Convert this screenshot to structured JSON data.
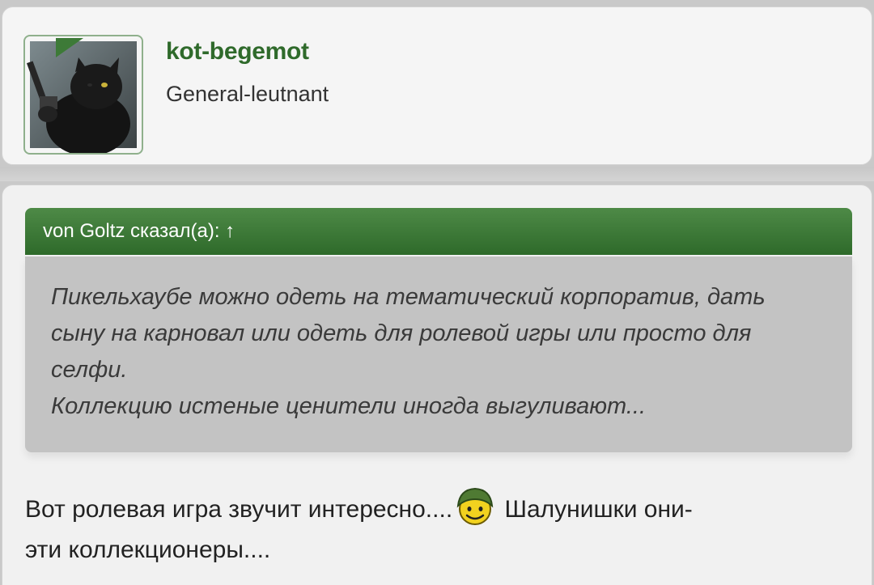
{
  "user": {
    "name": "kot-begemot",
    "rank": "General-leutnant"
  },
  "quote": {
    "header": "von Goltz сказал(а): ↑",
    "lines": [
      "Пикельхаубе можно одеть на тематический корпоратив, дать",
      "сыну на карновал или одеть для ролевой игры или просто для",
      "селфи.",
      "Коллекцию истеные ценители иногда выгуливают..."
    ]
  },
  "reply": {
    "part1": "Вот ролевая игра звучит интересно....",
    "part2": " Шалунишки они-",
    "line2": "эти коллекционеры...."
  },
  "colors": {
    "accent": "#2f6a2b",
    "quote_header": "#3d7a37",
    "quote_body": "#c3c3c3"
  }
}
